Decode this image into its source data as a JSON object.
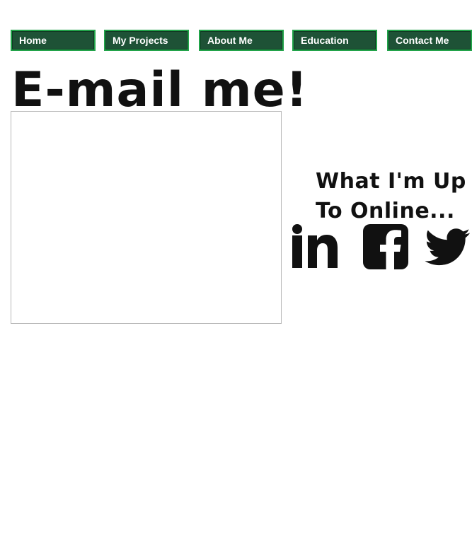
{
  "nav": {
    "items": [
      {
        "label": "Home"
      },
      {
        "label": "My Projects"
      },
      {
        "label": "About Me"
      },
      {
        "label": "Education"
      },
      {
        "label": "Contact Me"
      }
    ],
    "colors": {
      "fill": "#1e5236",
      "border": "#22a34a",
      "text": "#ffffff"
    }
  },
  "page": {
    "heading": "E-mail me!"
  },
  "online": {
    "title": "What I'm Up To Online..."
  },
  "social": {
    "icons": [
      "linkedin-icon",
      "facebook-icon",
      "twitter-icon"
    ]
  }
}
